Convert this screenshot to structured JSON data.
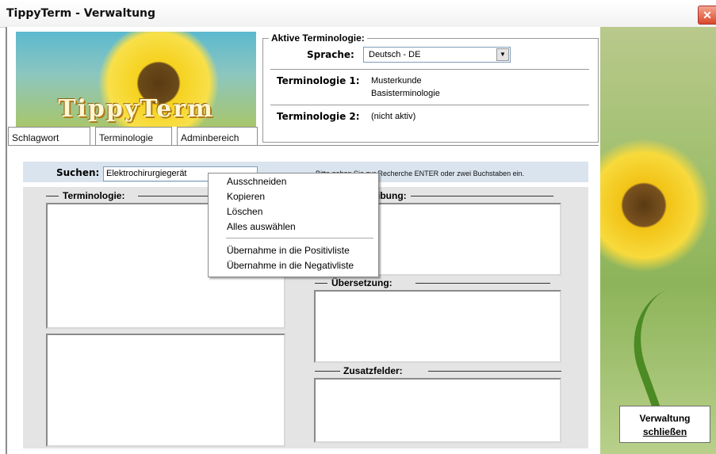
{
  "window": {
    "title": "TippyTerm - Verwaltung",
    "close_glyph": "✕"
  },
  "banner": {
    "logo_text": "TippyTerm"
  },
  "tabs": [
    {
      "label": "Schlagwort"
    },
    {
      "label": "Terminologie"
    },
    {
      "label": "Adminbereich"
    }
  ],
  "active_terminology": {
    "legend": "Aktive Terminologie:",
    "language_label": "Sprache:",
    "language_value": "Deutsch - DE",
    "term1_label": "Terminologie 1:",
    "term1_line1": "Musterkunde",
    "term1_line2": "Basisterminologie",
    "term2_label": "Terminologie 2:",
    "term2_value": "(nicht aktiv)"
  },
  "search": {
    "label": "Suchen:",
    "value": "Elektrochirurgiegerät",
    "hint_visible": "Bitte geben Sie zur Recherche ENTER oder zwei Buchstaben ein."
  },
  "groups": {
    "terminology": "Terminologie:",
    "description_partial": "ibung:",
    "translation": "Übersetzung:",
    "extra_fields": "Zusatzfelder:"
  },
  "context_menu": [
    "Ausschneiden",
    "Kopieren",
    "Löschen",
    "Alles auswählen",
    "Übernahme in die Positivliste",
    "Übernahme in die Negativliste"
  ],
  "close_button": {
    "line1": "Verwaltung",
    "line2": "schließen"
  },
  "icons": {
    "dropdown_arrow": "▼"
  }
}
